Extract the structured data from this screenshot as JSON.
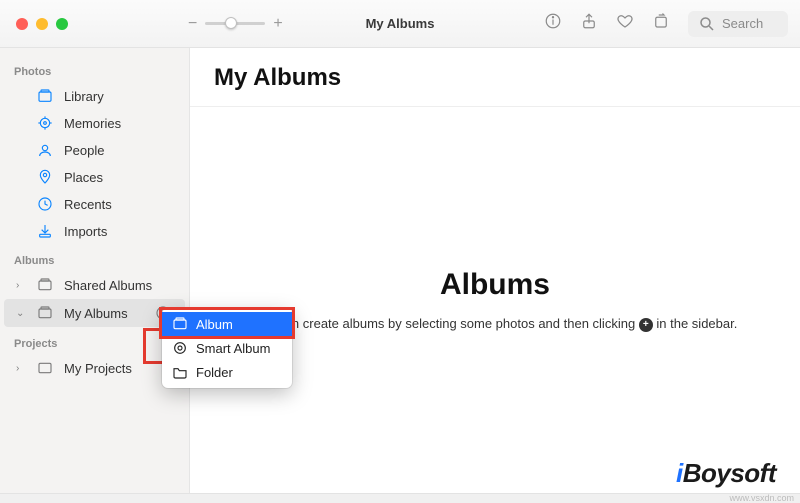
{
  "window": {
    "title": "My Albums",
    "search_placeholder": "Search"
  },
  "sidebar": {
    "sections": {
      "photos": "Photos",
      "albums": "Albums",
      "projects": "Projects"
    },
    "items": {
      "library": "Library",
      "memories": "Memories",
      "people": "People",
      "places": "Places",
      "recents": "Recents",
      "imports": "Imports",
      "shared_albums": "Shared Albums",
      "my_albums": "My Albums",
      "my_projects": "My Projects"
    }
  },
  "context_menu": {
    "album": "Album",
    "smart_album": "Smart Album",
    "folder": "Folder"
  },
  "main": {
    "heading": "My Albums",
    "empty_title": "Albums",
    "empty_text_before": "You can create albums by selecting some photos and then clicking ",
    "empty_text_after": " in the sidebar."
  },
  "watermark": {
    "i": "i",
    "rest": "Boysoft",
    "url": "www.vsxdn.com"
  }
}
